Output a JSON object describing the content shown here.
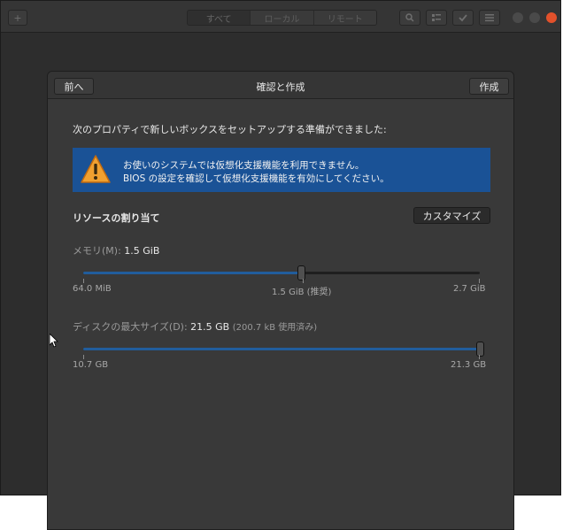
{
  "main_window": {
    "add_label": "+",
    "view_tabs": [
      "すべて",
      "ローカル",
      "リモート"
    ]
  },
  "dialog": {
    "back_label": "前へ",
    "title": "確認と作成",
    "create_label": "作成",
    "intro": "次のプロパティで新しいボックスをセットアップする準備ができました:",
    "warning": {
      "line1": "お使いのシステムでは仮想化支援機能を利用できません。",
      "line2": "BIOS の設定を確認して仮想化支援機能を有効にしてください。"
    },
    "resources_heading": "リソースの割り当て",
    "customize_label": "カスタマイズ",
    "memory": {
      "label": "メモリ(M):",
      "value": "1.5 GiB",
      "min_label": "64.0 MiB",
      "mid_label": "1.5 GiB (推奨)",
      "max_label": "2.7 GiB",
      "fraction": 0.55
    },
    "disk": {
      "label": "ディスクの最大サイズ(D):",
      "value": "21.5 GB",
      "used": "(200.7 kB 使用済み)",
      "min_label": "10.7 GB",
      "max_label": "21.3 GB",
      "fraction": 1.0
    }
  },
  "colors": {
    "accent": "#215d9c",
    "warning_bg": "#1a5296",
    "warning_icon": "#f0a030",
    "close": "#e2512b"
  }
}
